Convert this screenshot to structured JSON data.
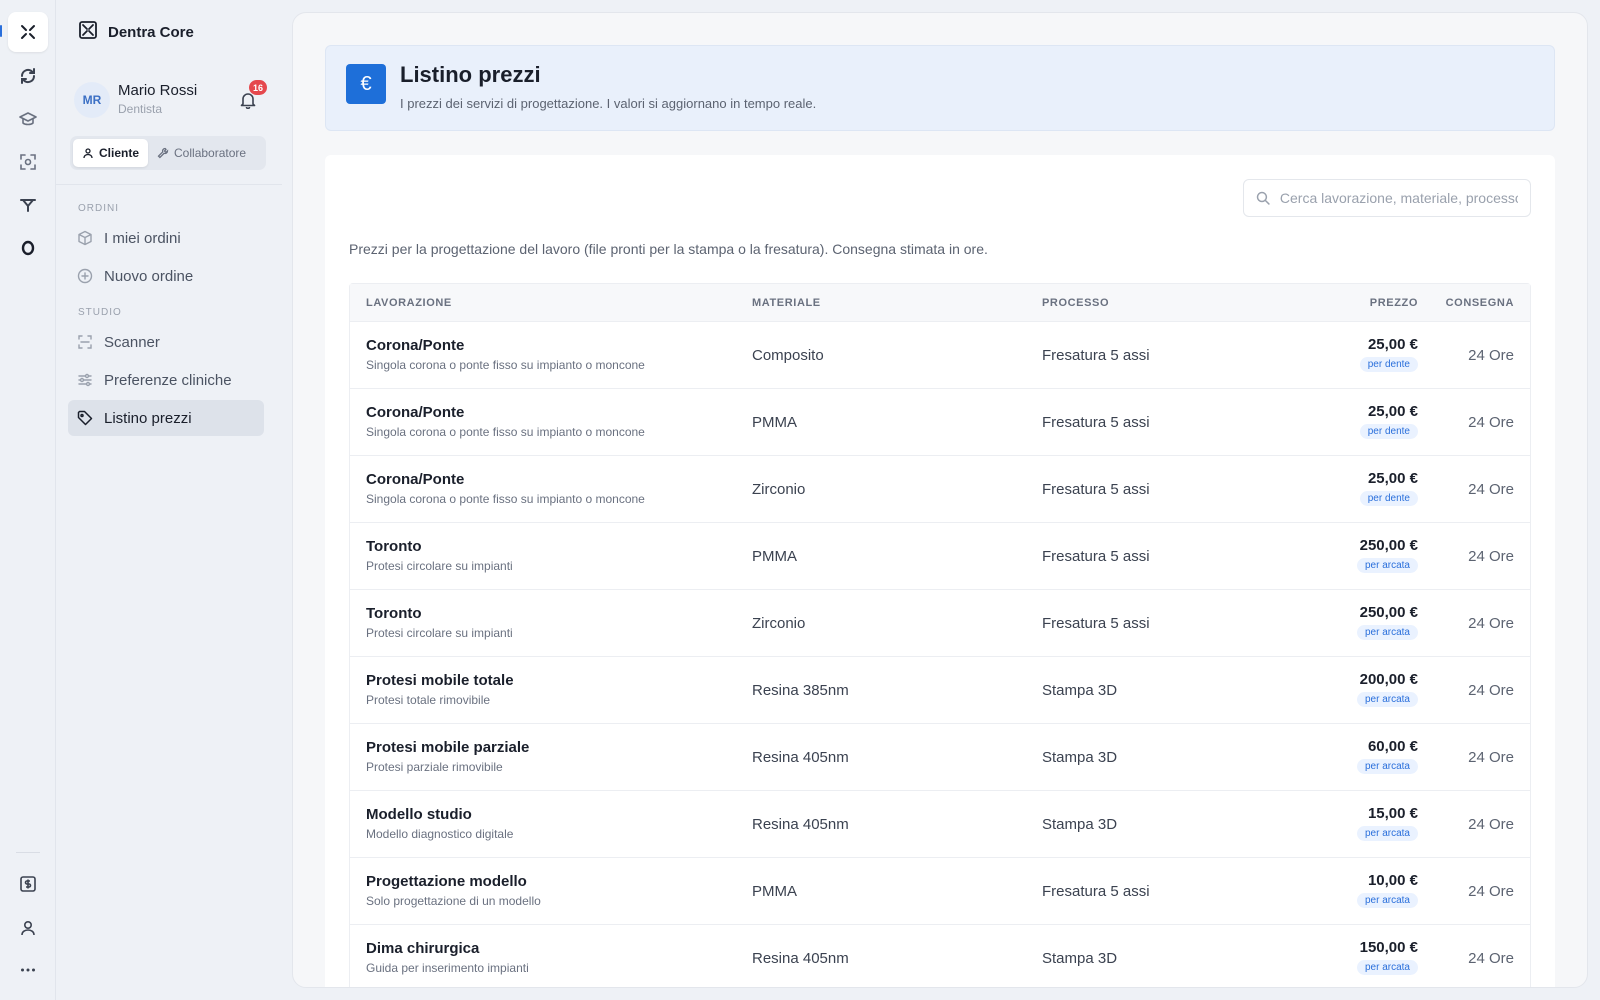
{
  "app": {
    "name": "Dentra Core"
  },
  "user": {
    "initials": "MR",
    "name": "Mario Rossi",
    "role": "Dentista",
    "notifications": "16"
  },
  "roles": {
    "client": "Cliente",
    "collaborator": "Collaboratore"
  },
  "sidebar": {
    "sections": [
      {
        "label": "ORDINI",
        "items": [
          "I miei ordini",
          "Nuovo ordine"
        ]
      },
      {
        "label": "STUDIO",
        "items": [
          "Scanner",
          "Preferenze cliniche",
          "Listino prezzi"
        ]
      }
    ]
  },
  "header": {
    "icon": "€",
    "title": "Listino prezzi",
    "subtitle": "I prezzi dei servizi di progettazione. I valori si aggiornano in tempo reale."
  },
  "search": {
    "placeholder": "Cerca lavorazione, materiale, processo"
  },
  "intro": "Prezzi per la progettazione del lavoro (file pronti per la stampa o la fresatura). Consegna stimata in ore.",
  "table": {
    "columns": {
      "work": "LAVORAZIONE",
      "material": "MATERIALE",
      "process": "PROCESSO",
      "price": "PREZZO",
      "delivery": "CONSEGNA"
    },
    "rows": [
      {
        "name": "Corona/Ponte",
        "desc": "Singola corona o ponte fisso su impianto o moncone",
        "material": "Composito",
        "process": "Fresatura 5 assi",
        "price": "25,00 €",
        "unit": "per dente",
        "delivery": "24 Ore"
      },
      {
        "name": "Corona/Ponte",
        "desc": "Singola corona o ponte fisso su impianto o moncone",
        "material": "PMMA",
        "process": "Fresatura 5 assi",
        "price": "25,00 €",
        "unit": "per dente",
        "delivery": "24 Ore"
      },
      {
        "name": "Corona/Ponte",
        "desc": "Singola corona o ponte fisso su impianto o moncone",
        "material": "Zirconio",
        "process": "Fresatura 5 assi",
        "price": "25,00 €",
        "unit": "per dente",
        "delivery": "24 Ore"
      },
      {
        "name": "Toronto",
        "desc": "Protesi circolare su impianti",
        "material": "PMMA",
        "process": "Fresatura 5 assi",
        "price": "250,00 €",
        "unit": "per arcata",
        "delivery": "24 Ore"
      },
      {
        "name": "Toronto",
        "desc": "Protesi circolare su impianti",
        "material": "Zirconio",
        "process": "Fresatura 5 assi",
        "price": "250,00 €",
        "unit": "per arcata",
        "delivery": "24 Ore"
      },
      {
        "name": "Protesi mobile totale",
        "desc": "Protesi totale rimovibile",
        "material": "Resina 385nm",
        "process": "Stampa 3D",
        "price": "200,00 €",
        "unit": "per arcata",
        "delivery": "24 Ore"
      },
      {
        "name": "Protesi mobile parziale",
        "desc": "Protesi parziale rimovibile",
        "material": "Resina 405nm",
        "process": "Stampa 3D",
        "price": "60,00 €",
        "unit": "per arcata",
        "delivery": "24 Ore"
      },
      {
        "name": "Modello studio",
        "desc": "Modello diagnostico digitale",
        "material": "Resina 405nm",
        "process": "Stampa 3D",
        "price": "15,00 €",
        "unit": "per arcata",
        "delivery": "24 Ore"
      },
      {
        "name": "Progettazione modello",
        "desc": "Solo progettazione di un modello",
        "material": "PMMA",
        "process": "Fresatura 5 assi",
        "price": "10,00 €",
        "unit": "per arcata",
        "delivery": "24 Ore"
      },
      {
        "name": "Dima chirurgica",
        "desc": "Guida per inserimento impianti",
        "material": "Resina 405nm",
        "process": "Stampa 3D",
        "price": "150,00 €",
        "unit": "per arcata",
        "delivery": "24 Ore"
      }
    ]
  }
}
